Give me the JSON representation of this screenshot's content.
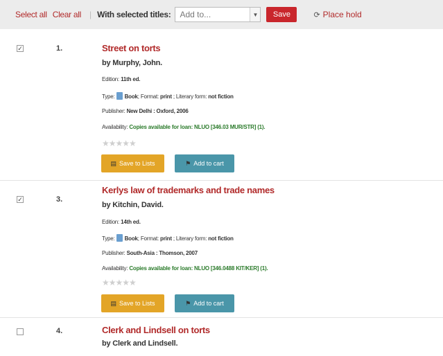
{
  "toolbar": {
    "select_all": "Select all",
    "clear_all": "Clear all",
    "separator": "|",
    "with_selected": "With selected titles:",
    "add_to_value": "Add to...",
    "save_label": "Save",
    "place_hold_label": "Place hold",
    "place_hold_icon": "hold-icon"
  },
  "labels": {
    "edition": "Edition:",
    "type": "Type:",
    "format": "; Format:",
    "literary_form": "; Literary form:",
    "publisher": "Publisher:",
    "availability": "Availability:",
    "save_to_lists": "Save to Lists",
    "add_to_cart": "Add to cart",
    "rating_stars": "★★★★★"
  },
  "results": [
    {
      "checked": true,
      "checkbox_mark": "✓",
      "number": "1.",
      "title": "Street on torts",
      "author": "by Murphy, John.",
      "edition": "11th ed.",
      "type": "Book",
      "format": "print",
      "literary_form": "not fiction",
      "publisher": "New Delhi : Oxford, 2006",
      "availability": "Copies available for loan: NLUO [346.03 MUR/STR] (1)."
    },
    {
      "checked": true,
      "checkbox_mark": "✓",
      "number": "3.",
      "title": "Kerlys law of trademarks and trade names",
      "author": "by Kitchin, David.",
      "edition": "14th ed.",
      "type": "Book",
      "format": "print",
      "literary_form": "not fiction",
      "publisher": "South-Asia : Thomson, 2007",
      "availability": "Copies available for loan: NLUO [346.0488 KIT/KER] (1)."
    },
    {
      "checked": false,
      "checkbox_mark": "",
      "number": "4.",
      "title": "Clerk and Lindsell on torts",
      "author": "by Clerk and Lindsell."
    }
  ],
  "colors": {
    "link_red": "#b12a2a",
    "save_red": "#c9262c",
    "availability_green": "#2a7a2a",
    "lists_button": "#e3a527",
    "cart_button": "#4a96a9",
    "toolbar_bg": "#ececec"
  }
}
